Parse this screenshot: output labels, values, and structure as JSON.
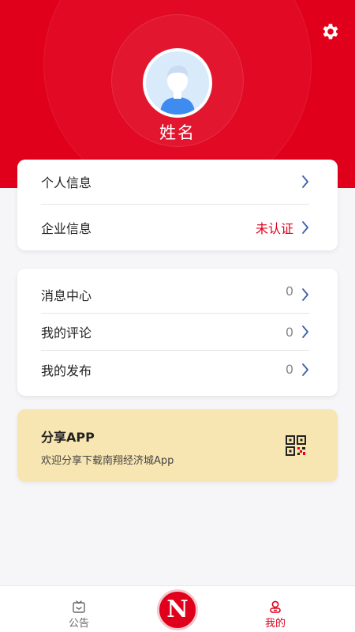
{
  "profile": {
    "name": "姓名"
  },
  "menu1": [
    {
      "label": "个人信息",
      "value": ""
    },
    {
      "label": "企业信息",
      "value": "未认证"
    }
  ],
  "menu2": [
    {
      "label": "消息中心",
      "value": "0"
    },
    {
      "label": "我的评论",
      "value": "0"
    },
    {
      "label": "我的发布",
      "value": "0"
    }
  ],
  "share": {
    "title": "分享APP",
    "subtitle": "欢迎分享下载南翔经济城App"
  },
  "tabbar": {
    "notice": "公告",
    "center": "N",
    "mine": "我的"
  },
  "colors": {
    "brand": "#e0001b",
    "share_bg": "#f8e6b2"
  },
  "icons": [
    "gear-icon",
    "avatar-icon",
    "chevron-right-icon",
    "qr-code-icon",
    "notice-icon",
    "app-logo-icon",
    "user-icon"
  ]
}
